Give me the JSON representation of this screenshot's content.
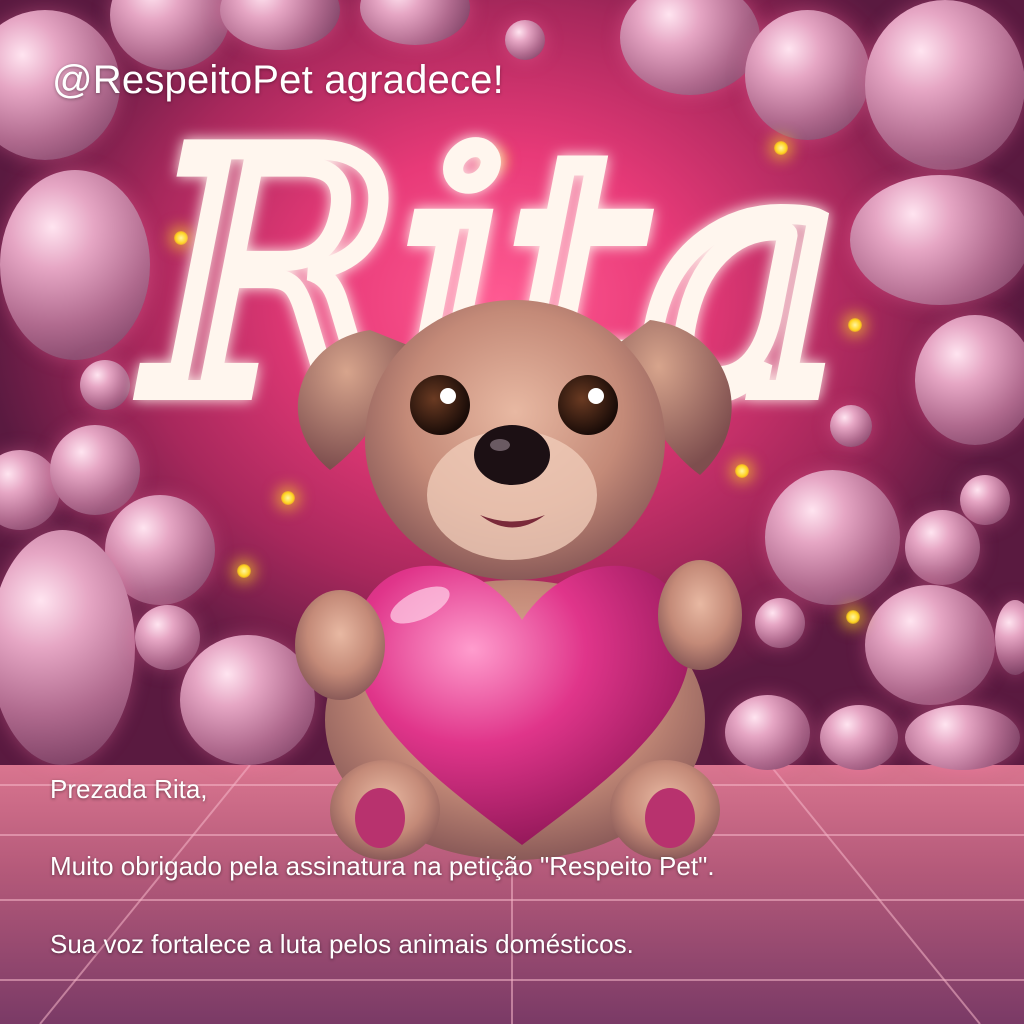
{
  "header": {
    "title": "@RespeitoPet agradece!"
  },
  "neon_sign": {
    "text": "Rita",
    "color": "#fff6ee"
  },
  "message": {
    "greeting": "Prezada Rita,",
    "thanks": "Muito obrigado pela assinatura na petição \"Respeito Pet\".",
    "voice": "Sua voz fortalece a luta pelos animais domésticos."
  },
  "illustration": {
    "subject": "puppy-holding-heart",
    "heart_color": "#e0358a",
    "background_color": "#e83a78"
  }
}
